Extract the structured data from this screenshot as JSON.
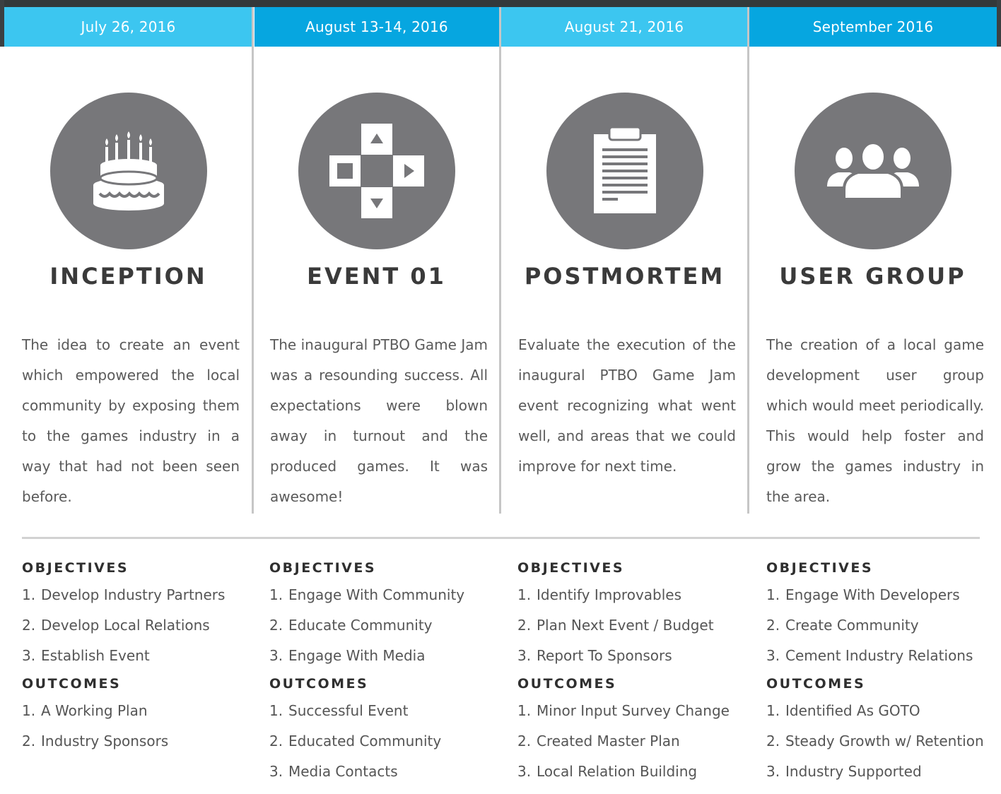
{
  "colors": {
    "date_bar_light": "#3cc6f0",
    "date_bar_dark": "#06a6e0",
    "icon_circle": "#77777a",
    "heading": "#3a3a3a",
    "body_text": "#5a5a5a",
    "divider": "#c6c6c6"
  },
  "phases": [
    {
      "date": "July 26, 2016",
      "icon": "birthday-cake-icon",
      "title": "INCEPTION",
      "description": "The idea to create an event which empowered the local community by exposing them to the games industry in a way that had not been seen before.",
      "objectives_heading": "OBJECTIVES",
      "objectives": [
        "Develop Industry Partners",
        "Develop Local Relations",
        "Establish Event"
      ],
      "outcomes_heading": "OUTCOMES",
      "outcomes": [
        "A Working Plan",
        "Industry Sponsors"
      ]
    },
    {
      "date": "August 13-14, 2016",
      "icon": "gamepad-dpad-icon",
      "title": "EVENT 01",
      "description": "The inaugural PTBO Game Jam was a resounding success. All expectations were blown away in turnout and the produced games. It was awesome!",
      "objectives_heading": "OBJECTIVES",
      "objectives": [
        "Engage With Community",
        "Educate Community",
        "Engage With Media"
      ],
      "outcomes_heading": "OUTCOMES",
      "outcomes": [
        "Successful Event",
        "Educated Community",
        "Media Contacts"
      ]
    },
    {
      "date": "August 21, 2016",
      "icon": "clipboard-icon",
      "title": "POSTMORTEM",
      "description": "Evaluate the execution of the inaugural PTBO Game Jam event recognizing what went well, and areas that we could improve for next time.",
      "objectives_heading": "OBJECTIVES",
      "objectives": [
        "Identify Improvables",
        "Plan Next Event / Budget",
        "Report To Sponsors"
      ],
      "outcomes_heading": "OUTCOMES",
      "outcomes": [
        "Minor Input Survey Change",
        "Created Master Plan",
        "Local Relation Building"
      ]
    },
    {
      "date": "September 2016",
      "icon": "user-group-icon",
      "title": "USER GROUP",
      "description": "The creation of a local game development user group which would meet periodically. This would help foster and grow the games industry in the area.",
      "objectives_heading": "OBJECTIVES",
      "objectives": [
        "Engage With Developers",
        "Create Community",
        "Cement Industry Relations"
      ],
      "outcomes_heading": "OUTCOMES",
      "outcomes": [
        "Identified As GOTO",
        "Steady Growth w/ Retention",
        "Industry Supported"
      ]
    }
  ]
}
